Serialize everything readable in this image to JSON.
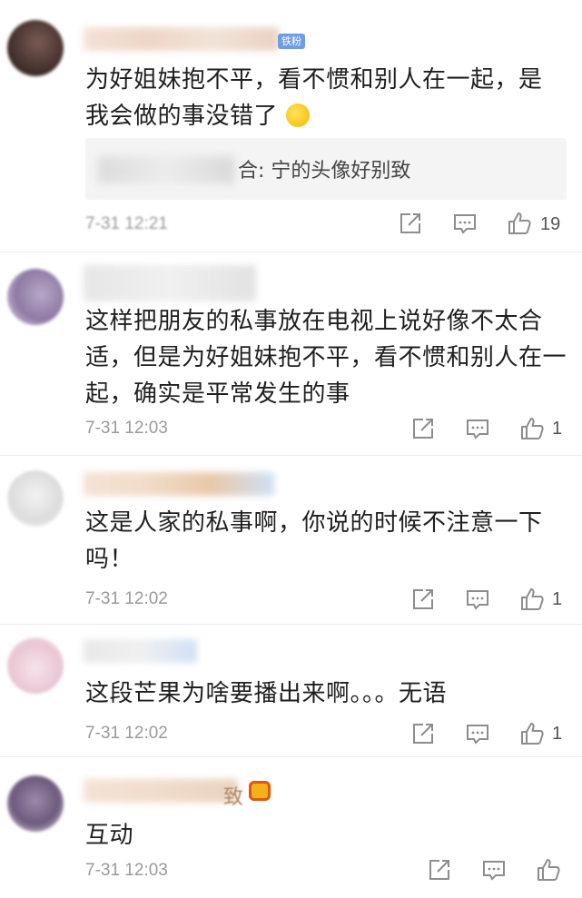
{
  "comments": [
    {
      "badge": "铁粉",
      "text_line1": "为好姐妹抱不平，看不惯和别人在一起，是",
      "text_line2": "我会做的事没错了",
      "reply": "合: 宁的头像好别致",
      "time": "7-31 12:21",
      "likes": "19",
      "emoji": "laugh-cry-emoji"
    },
    {
      "text": "这样把朋友的私事放在电视上说好像不太合适，但是为好姐妹抱不平，看不惯和别人在一起，确实是平常发生的事",
      "time": "7-31 12:03",
      "likes": "1"
    },
    {
      "text": "这是人家的私事啊，你说的时候不注意一下吗！",
      "time": "7-31 12:02",
      "likes": "1"
    },
    {
      "text": "这段芒果为啥要播出来啊。。。无语",
      "time": "7-31 12:02",
      "likes": "1"
    },
    {
      "name_suffix": "致",
      "text": "互动",
      "time": "7-31 12:03",
      "likes": ""
    }
  ],
  "icons": {
    "share": "share-icon",
    "comment": "comment-icon",
    "like": "thumbs-up-icon"
  },
  "colors": {
    "badge": "#6e9de8",
    "meta": "#9a9a9a"
  }
}
